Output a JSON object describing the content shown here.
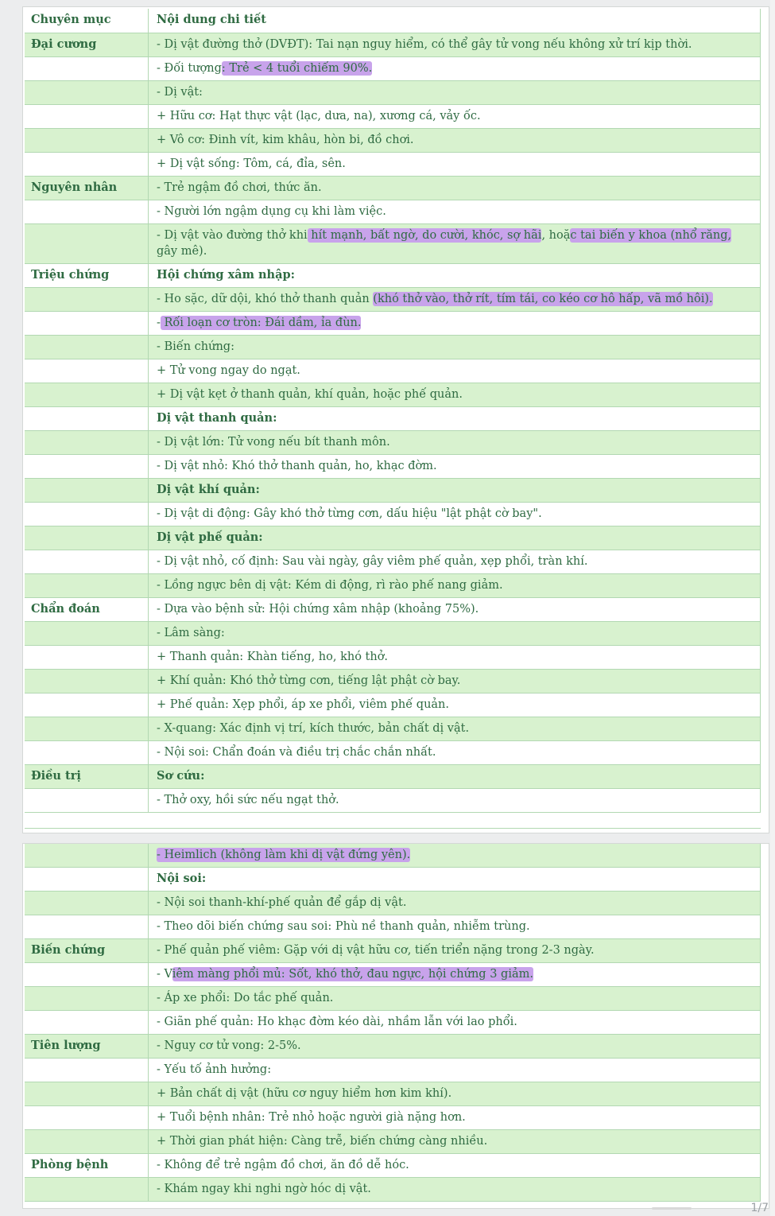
{
  "table": {
    "header": {
      "col1": "Chuyên mục",
      "col2": "Nội dung chi tiết"
    },
    "page1_rows": [
      {
        "c1": "Đại cương",
        "c2": "- Dị vật đường thở (DVĐT): Tai nạn nguy hiểm, có thể gây tử vong nếu không xử trí kịp thời."
      },
      {
        "c1": "",
        "c2_pre": "- Đối tượng",
        "c2_hl": ": Trẻ < 4 tuổi chiếm 90%.",
        "c2_post": ""
      },
      {
        "c1": "",
        "c2": "- Dị vật:"
      },
      {
        "c1": "",
        "c2": "+ Hữu cơ: Hạt thực vật (lạc, dưa, na), xương cá, vảy ốc."
      },
      {
        "c1": "",
        "c2": "+ Vô cơ: Đinh vít, kim khâu, hòn bi, đồ chơi."
      },
      {
        "c1": "",
        "c2": "+ Dị vật sống: Tôm, cá, đỉa, sên."
      },
      {
        "c1": "Nguyên nhân",
        "c2": "- Trẻ ngậm đồ chơi, thức ăn."
      },
      {
        "c1": "",
        "c2": "- Người lớn ngậm dụng cụ khi làm việc."
      },
      {
        "c1": "",
        "c2_pre": "- Dị vật vào đường thở khi",
        "c2_hl": " hít mạnh, bất ngờ, do cười, khóc, sợ hãi",
        "c2_mid": ", hoặ",
        "c2_hl2": "c tai biến y khoa (nhổ răng,",
        "c2_post": " gây mê)."
      },
      {
        "c1": "Triệu chứng",
        "c2": "Hội chứng xâm nhập:",
        "bold": true
      },
      {
        "c1": "",
        "c2_pre": "- Ho sặc, dữ dội, khó thở thanh quản ",
        "c2_hl": "(khó thở vào, thở rít, tím tái, co kéo cơ hô hấp, vã mồ hôi).",
        "c2_post": ""
      },
      {
        "c1": "",
        "c2_pre": "-",
        "c2_hl": " Rối loạn cơ tròn: Đái dầm, ỉa đùn.   ",
        "c2_post": ""
      },
      {
        "c1": "",
        "c2": "- Biến chứng:"
      },
      {
        "c1": "",
        "c2": "+ Tử vong ngay do ngạt."
      },
      {
        "c1": "",
        "c2": "+ Dị vật kẹt ở thanh quản, khí quản, hoặc phế quản."
      },
      {
        "c1": "",
        "c2": "Dị vật thanh quản:",
        "bold": true
      },
      {
        "c1": "",
        "c2": "- Dị vật lớn: Tử vong nếu bít thanh môn."
      },
      {
        "c1": "",
        "c2": "- Dị vật nhỏ: Khó thở thanh quản, ho, khạc đờm."
      },
      {
        "c1": "",
        "c2": "Dị vật khí quản:",
        "bold": true
      },
      {
        "c1": "",
        "c2": "- Dị vật di động: Gây khó thở từng cơn, dấu hiệu \"lật phật cờ bay\"."
      },
      {
        "c1": "",
        "c2": "Dị vật phế quản:",
        "bold": true
      },
      {
        "c1": "",
        "c2": "- Dị vật nhỏ, cố định: Sau vài ngày, gây viêm phế quản, xẹp phổi, tràn khí."
      },
      {
        "c1": "",
        "c2": "- Lồng ngực bên dị vật: Kém di động, rì rào phế nang giảm."
      },
      {
        "c1": "Chẩn đoán",
        "c2": "- Dựa vào bệnh sử: Hội chứng xâm nhập (khoảng 75%)."
      },
      {
        "c1": "",
        "c2": "- Lâm sàng:"
      },
      {
        "c1": "",
        "c2": "+ Thanh quản: Khàn tiếng, ho, khó thở."
      },
      {
        "c1": "",
        "c2": "+ Khí quản: Khó thở từng cơn, tiếng lật phật cờ bay."
      },
      {
        "c1": "",
        "c2": "+ Phế quản: Xẹp phổi, áp xe phổi, viêm phế quản."
      },
      {
        "c1": "",
        "c2": "- X-quang: Xác định vị trí, kích thước, bản chất dị vật."
      },
      {
        "c1": "",
        "c2": "- Nội soi: Chẩn đoán và điều trị chắc chắn nhất."
      },
      {
        "c1": "Điều trị",
        "c2": "Sơ cứu:",
        "bold": true
      },
      {
        "c1": "",
        "c2": "- Thở oxy, hồi sức nếu ngạt thở."
      }
    ],
    "page2_rows": [
      {
        "c1": "",
        "c2_pre": "",
        "c2_hl": "- Heimlich (không làm khi dị vật đứng yên).",
        "c2_post": ""
      },
      {
        "c1": "",
        "c2": "Nội soi:",
        "bold": true
      },
      {
        "c1": "",
        "c2": "- Nội soi thanh-khí-phế quản để gắp dị vật."
      },
      {
        "c1": "",
        "c2": "- Theo dõi biến chứng sau soi: Phù nề thanh quản, nhiễm trùng."
      },
      {
        "c1": "Biến chứng",
        "c2": "- Phế quản phế viêm: Gặp với dị vật hữu cơ, tiến triển nặng trong 2-3 ngày."
      },
      {
        "c1": "",
        "c2_pre": "- V",
        "c2_hl": "iêm màng phổi mủ: Sốt, khó thở, đau ngực, hội chứng 3 giảm.",
        "c2_post": ""
      },
      {
        "c1": "",
        "c2": "- Áp xe phổi: Do tắc phế quản."
      },
      {
        "c1": "",
        "c2": "- Giãn phế quản: Ho khạc đờm kéo dài, nhầm lẫn với lao phổi."
      },
      {
        "c1": "Tiên lượng",
        "c2": "- Nguy cơ tử vong: 2-5%."
      },
      {
        "c1": "",
        "c2": "- Yếu tố ảnh hưởng:"
      },
      {
        "c1": "",
        "c2": "+ Bản chất dị vật (hữu cơ nguy hiểm hơn kim khí)."
      },
      {
        "c1": "",
        "c2": "+ Tuổi bệnh nhân: Trẻ nhỏ hoặc người già nặng hơn."
      },
      {
        "c1": "",
        "c2": "+ Thời gian phát hiện: Càng trễ, biến chứng càng nhiều."
      },
      {
        "c1": "Phòng bệnh",
        "c2": "- Không để trẻ ngậm đồ chơi, ăn đồ dễ hóc."
      },
      {
        "c1": "",
        "c2": "- Khám ngay khi nghi ngờ hóc dị vật."
      }
    ]
  },
  "page_number": "1/7",
  "colors": {
    "row_green": "#d8f2cf",
    "text_green": "#2f6b42",
    "highlight_purple": "#c8a3eb",
    "border_green": "#b2d8b2"
  }
}
